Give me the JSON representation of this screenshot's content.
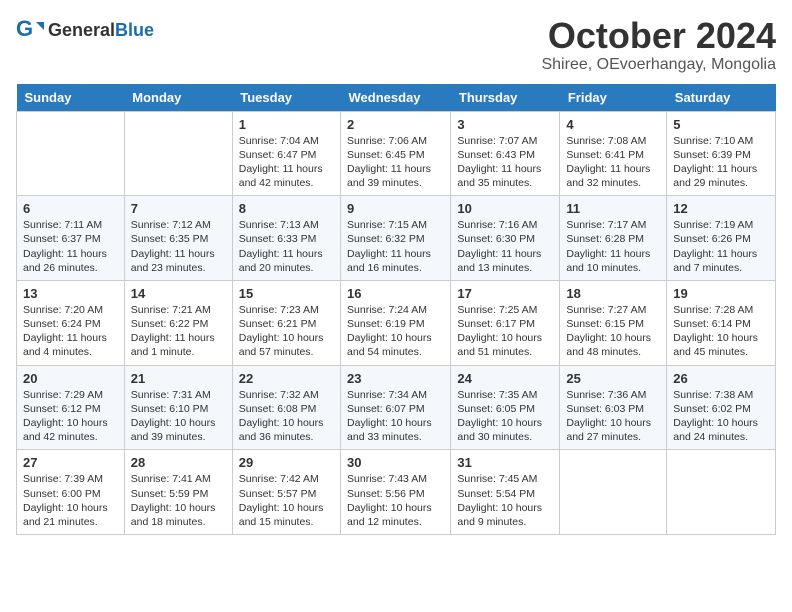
{
  "header": {
    "logo_general": "General",
    "logo_blue": "Blue",
    "month": "October 2024",
    "location": "Shiree, OEvoerhangay, Mongolia"
  },
  "weekdays": [
    "Sunday",
    "Monday",
    "Tuesday",
    "Wednesday",
    "Thursday",
    "Friday",
    "Saturday"
  ],
  "weeks": [
    [
      {
        "day": "",
        "info": ""
      },
      {
        "day": "",
        "info": ""
      },
      {
        "day": "1",
        "info": "Sunrise: 7:04 AM\nSunset: 6:47 PM\nDaylight: 11 hours and 42 minutes."
      },
      {
        "day": "2",
        "info": "Sunrise: 7:06 AM\nSunset: 6:45 PM\nDaylight: 11 hours and 39 minutes."
      },
      {
        "day": "3",
        "info": "Sunrise: 7:07 AM\nSunset: 6:43 PM\nDaylight: 11 hours and 35 minutes."
      },
      {
        "day": "4",
        "info": "Sunrise: 7:08 AM\nSunset: 6:41 PM\nDaylight: 11 hours and 32 minutes."
      },
      {
        "day": "5",
        "info": "Sunrise: 7:10 AM\nSunset: 6:39 PM\nDaylight: 11 hours and 29 minutes."
      }
    ],
    [
      {
        "day": "6",
        "info": "Sunrise: 7:11 AM\nSunset: 6:37 PM\nDaylight: 11 hours and 26 minutes."
      },
      {
        "day": "7",
        "info": "Sunrise: 7:12 AM\nSunset: 6:35 PM\nDaylight: 11 hours and 23 minutes."
      },
      {
        "day": "8",
        "info": "Sunrise: 7:13 AM\nSunset: 6:33 PM\nDaylight: 11 hours and 20 minutes."
      },
      {
        "day": "9",
        "info": "Sunrise: 7:15 AM\nSunset: 6:32 PM\nDaylight: 11 hours and 16 minutes."
      },
      {
        "day": "10",
        "info": "Sunrise: 7:16 AM\nSunset: 6:30 PM\nDaylight: 11 hours and 13 minutes."
      },
      {
        "day": "11",
        "info": "Sunrise: 7:17 AM\nSunset: 6:28 PM\nDaylight: 11 hours and 10 minutes."
      },
      {
        "day": "12",
        "info": "Sunrise: 7:19 AM\nSunset: 6:26 PM\nDaylight: 11 hours and 7 minutes."
      }
    ],
    [
      {
        "day": "13",
        "info": "Sunrise: 7:20 AM\nSunset: 6:24 PM\nDaylight: 11 hours and 4 minutes."
      },
      {
        "day": "14",
        "info": "Sunrise: 7:21 AM\nSunset: 6:22 PM\nDaylight: 11 hours and 1 minute."
      },
      {
        "day": "15",
        "info": "Sunrise: 7:23 AM\nSunset: 6:21 PM\nDaylight: 10 hours and 57 minutes."
      },
      {
        "day": "16",
        "info": "Sunrise: 7:24 AM\nSunset: 6:19 PM\nDaylight: 10 hours and 54 minutes."
      },
      {
        "day": "17",
        "info": "Sunrise: 7:25 AM\nSunset: 6:17 PM\nDaylight: 10 hours and 51 minutes."
      },
      {
        "day": "18",
        "info": "Sunrise: 7:27 AM\nSunset: 6:15 PM\nDaylight: 10 hours and 48 minutes."
      },
      {
        "day": "19",
        "info": "Sunrise: 7:28 AM\nSunset: 6:14 PM\nDaylight: 10 hours and 45 minutes."
      }
    ],
    [
      {
        "day": "20",
        "info": "Sunrise: 7:29 AM\nSunset: 6:12 PM\nDaylight: 10 hours and 42 minutes."
      },
      {
        "day": "21",
        "info": "Sunrise: 7:31 AM\nSunset: 6:10 PM\nDaylight: 10 hours and 39 minutes."
      },
      {
        "day": "22",
        "info": "Sunrise: 7:32 AM\nSunset: 6:08 PM\nDaylight: 10 hours and 36 minutes."
      },
      {
        "day": "23",
        "info": "Sunrise: 7:34 AM\nSunset: 6:07 PM\nDaylight: 10 hours and 33 minutes."
      },
      {
        "day": "24",
        "info": "Sunrise: 7:35 AM\nSunset: 6:05 PM\nDaylight: 10 hours and 30 minutes."
      },
      {
        "day": "25",
        "info": "Sunrise: 7:36 AM\nSunset: 6:03 PM\nDaylight: 10 hours and 27 minutes."
      },
      {
        "day": "26",
        "info": "Sunrise: 7:38 AM\nSunset: 6:02 PM\nDaylight: 10 hours and 24 minutes."
      }
    ],
    [
      {
        "day": "27",
        "info": "Sunrise: 7:39 AM\nSunset: 6:00 PM\nDaylight: 10 hours and 21 minutes."
      },
      {
        "day": "28",
        "info": "Sunrise: 7:41 AM\nSunset: 5:59 PM\nDaylight: 10 hours and 18 minutes."
      },
      {
        "day": "29",
        "info": "Sunrise: 7:42 AM\nSunset: 5:57 PM\nDaylight: 10 hours and 15 minutes."
      },
      {
        "day": "30",
        "info": "Sunrise: 7:43 AM\nSunset: 5:56 PM\nDaylight: 10 hours and 12 minutes."
      },
      {
        "day": "31",
        "info": "Sunrise: 7:45 AM\nSunset: 5:54 PM\nDaylight: 10 hours and 9 minutes."
      },
      {
        "day": "",
        "info": ""
      },
      {
        "day": "",
        "info": ""
      }
    ]
  ]
}
